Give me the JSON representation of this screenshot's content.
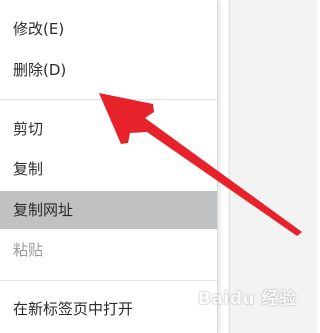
{
  "menu": {
    "items": [
      {
        "label": "修改(E)",
        "state": "normal"
      },
      {
        "label": "删除(D)",
        "state": "normal"
      },
      {
        "label": "剪切",
        "state": "normal"
      },
      {
        "label": "复制",
        "state": "normal"
      },
      {
        "label": "复制网址",
        "state": "highlighted"
      },
      {
        "label": "粘贴",
        "state": "disabled"
      },
      {
        "label": "在新标签页中打开",
        "state": "normal"
      }
    ]
  },
  "watermark": {
    "text": "Baidu 经验"
  },
  "colors": {
    "arrow": "#e8222a",
    "highlight": "#c0c1c3",
    "text": "#2b2b2b",
    "disabled_text": "#9a9a9a",
    "separator": "#e3e3e3"
  }
}
